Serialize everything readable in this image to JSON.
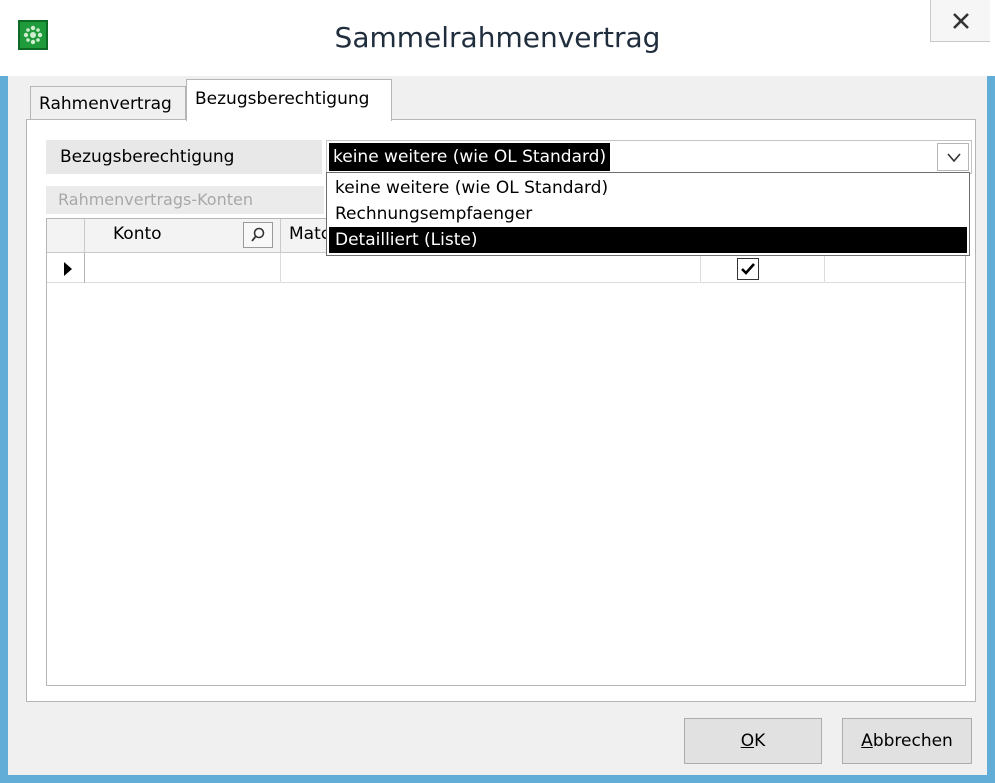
{
  "window": {
    "title": "Sammelrahmenvertrag",
    "close_label": "X"
  },
  "tabs": [
    {
      "label": "Rahmenvertrag",
      "active": false
    },
    {
      "label": "Bezugsberechtigung",
      "active": true
    }
  ],
  "bezug": {
    "label": "Bezugsberechtigung",
    "selected_value": "keine weitere (wie OL Standard)",
    "options": [
      "keine weitere (wie OL Standard)",
      "Rechnungsempfaenger",
      "Detailliert (Liste)"
    ],
    "highlighted_option_index": 2
  },
  "group": {
    "label": "Rahmenvertrags-Konten"
  },
  "grid": {
    "columns": [
      "Konto",
      "Match"
    ],
    "rows": [
      {
        "konto": "",
        "match": "",
        "checked": true
      }
    ]
  },
  "buttons": {
    "ok_accel": "O",
    "ok_rest": "K",
    "cancel_accel": "A",
    "cancel_rest": "bbrechen"
  },
  "colors": {
    "frame": "#62acd8",
    "selection": "#000000",
    "app_icon": "#1f9b3c"
  }
}
